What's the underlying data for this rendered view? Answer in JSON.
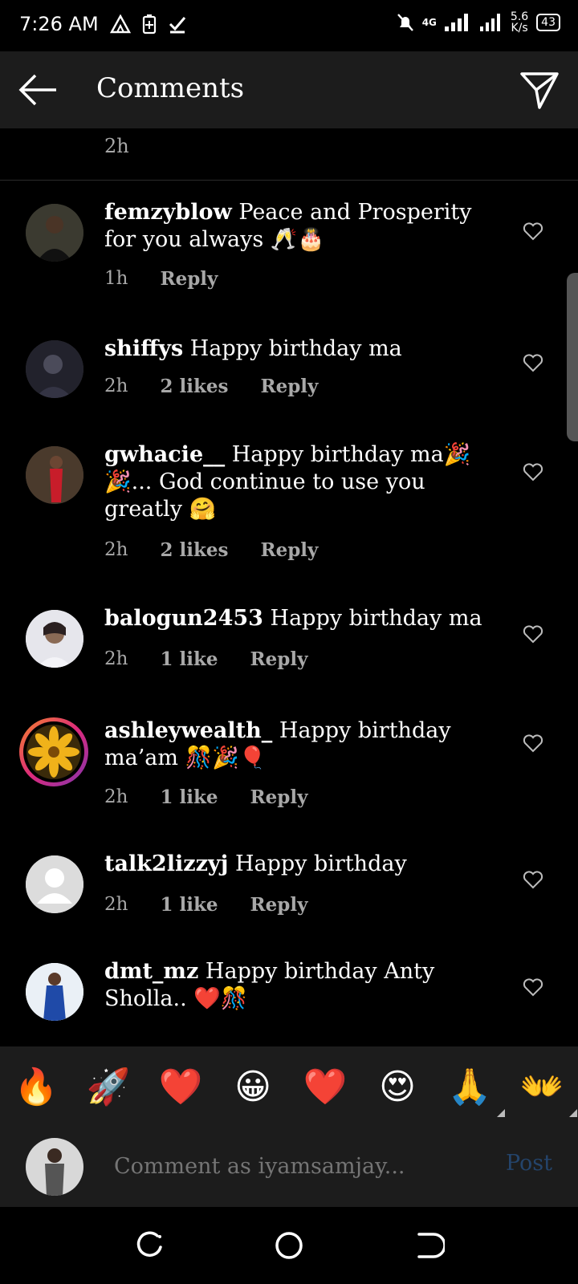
{
  "status": {
    "time": "7:26 AM",
    "network": "4G",
    "speed_value": "5.6",
    "speed_unit": "K/s",
    "battery": "43"
  },
  "header": {
    "title": "Comments"
  },
  "previous": {
    "time": "2h"
  },
  "comments": [
    {
      "user": "femzyblow",
      "text": "Peace and Prosperity for you always 🥂🎂",
      "time": "1h",
      "likes": "",
      "reply": "Reply"
    },
    {
      "user": "shiffys",
      "text": "Happy birthday ma",
      "time": "2h",
      "likes": "2 likes",
      "reply": "Reply"
    },
    {
      "user": "gwhacie__",
      "text": "Happy birthday ma🎉🎉... God continue to use you greatly 🤗",
      "time": "2h",
      "likes": "2 likes",
      "reply": "Reply"
    },
    {
      "user": "balogun2453",
      "text": "Happy birthday ma",
      "time": "2h",
      "likes": "1 like",
      "reply": "Reply"
    },
    {
      "user": "ashleywealth_",
      "text": "Happy birthday ma’am 🎊🎉🎈",
      "time": "2h",
      "likes": "1 like",
      "reply": "Reply"
    },
    {
      "user": "talk2lizzyj",
      "text": "Happy birthday",
      "time": "2h",
      "likes": "1 like",
      "reply": "Reply"
    },
    {
      "user": "dmt_mz",
      "text": "Happy birthday Anty Sholla.. ❤️🎊",
      "time": "",
      "likes": "",
      "reply": ""
    }
  ],
  "emoji_bar": [
    "🔥",
    "🚀",
    "❤️",
    "😀",
    "❤️",
    "😍",
    "🙏",
    "👐"
  ],
  "composer": {
    "placeholder": "Comment as iyamsamjay...",
    "post_label": "Post"
  },
  "colors": {
    "background": "#000000",
    "bar": "#1c1c1c",
    "secondary_text": "#a8a8a8",
    "post_disabled": "#24446b",
    "story_ring": "#dd2a7b"
  }
}
